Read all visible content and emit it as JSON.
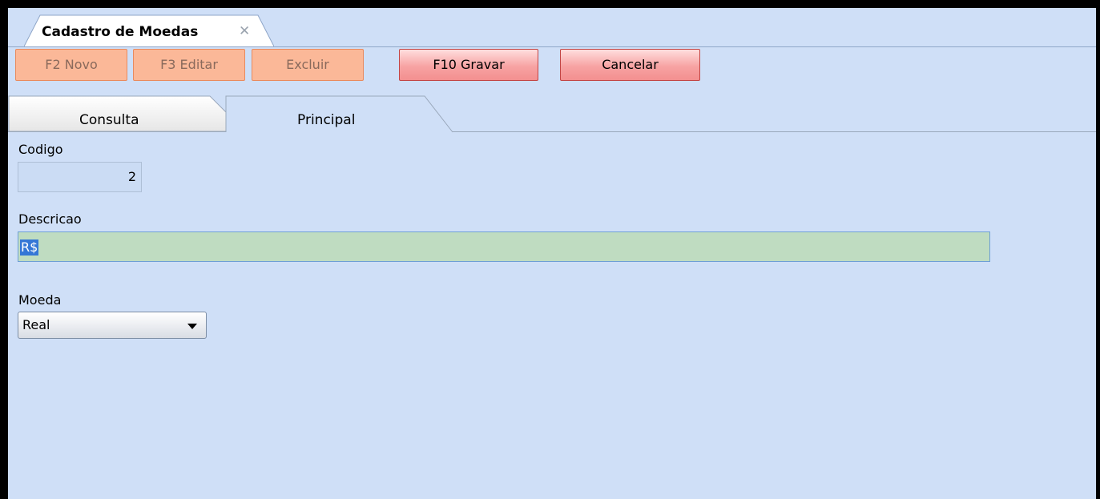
{
  "document_tab": {
    "title": "Cadastro de Moedas",
    "close_glyph": "✕"
  },
  "toolbar": {
    "novo_label": "F2 Novo",
    "editar_label": "F3 Editar",
    "excluir_label": "Excluir",
    "gravar_label": "F10 Gravar",
    "cancelar_label": "Cancelar"
  },
  "tabs": {
    "consulta": "Consulta",
    "principal": "Principal",
    "selected": "Principal"
  },
  "form": {
    "codigo_label": "Codigo",
    "codigo_value": "2",
    "descricao_label": "Descricao",
    "descricao_value": "R$",
    "moeda_label": "Moeda",
    "moeda_value": "Real"
  },
  "colors": {
    "window_background": "#cfdff7",
    "disabled_button": "#fbb898",
    "active_button": "#f7a3a3",
    "input_focus_background": "#bfdcc1",
    "selection": "#3577d6"
  },
  "icons": {
    "close": "close-icon",
    "dropdown": "chevron-down-icon"
  }
}
